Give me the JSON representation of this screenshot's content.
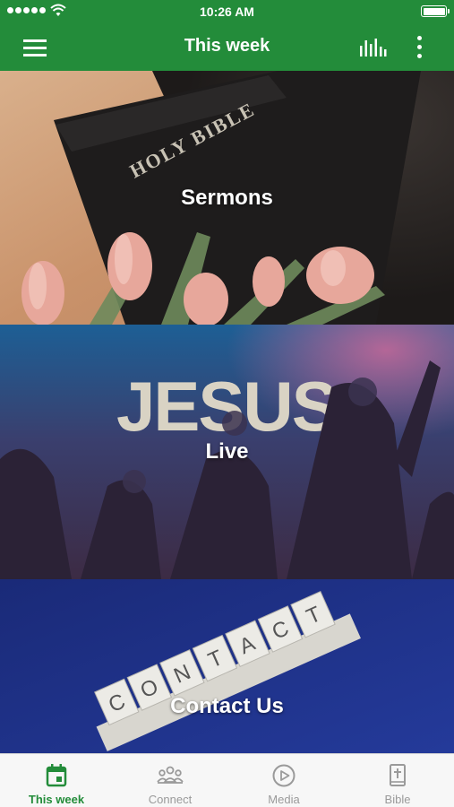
{
  "status_bar": {
    "time": "10:26 AM"
  },
  "app_bar": {
    "title": "This week"
  },
  "tiles": [
    {
      "label": "Sermons"
    },
    {
      "label": "Live",
      "image_text": "JESUS"
    },
    {
      "label": "Contact Us",
      "image_text": "CONTACT"
    }
  ],
  "tab_bar": {
    "tabs": [
      {
        "label": "This week",
        "icon": "calendar-icon",
        "active": true
      },
      {
        "label": "Connect",
        "icon": "people-group-icon",
        "active": false
      },
      {
        "label": "Media",
        "icon": "play-circle-icon",
        "active": false
      },
      {
        "label": "Bible",
        "icon": "bible-cross-icon",
        "active": false
      }
    ]
  },
  "colors": {
    "brand_green": "#238c3a",
    "tab_inactive": "#9a9a9a",
    "tab_bar_bg": "#f7f7f7"
  }
}
